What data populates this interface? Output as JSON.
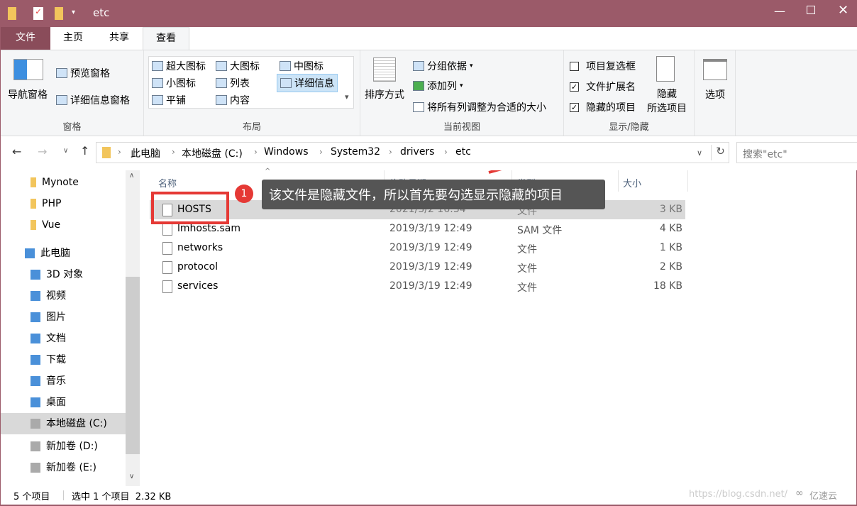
{
  "window": {
    "title": "etc"
  },
  "tabs": [
    "文件",
    "主页",
    "共享",
    "查看"
  ],
  "ribbon": {
    "panes": {
      "nav": "导航窗格",
      "preview": "预览窗格",
      "details": "详细信息窗格",
      "label": "窗格"
    },
    "layout": {
      "items": [
        "超大图标",
        "大图标",
        "中图标",
        "小图标",
        "列表",
        "详细信息",
        "平铺",
        "内容"
      ],
      "selected": "详细信息",
      "label": "布局"
    },
    "view": {
      "sort": "排序方式",
      "group": "分组依据",
      "add_col": "添加列",
      "fit": "将所有列调整为合适的大小",
      "label": "当前视图"
    },
    "show": {
      "item_cb": "项目复选框",
      "ext": "文件扩展名",
      "hidden": "隐藏的项目",
      "item_cb_checked": false,
      "ext_checked": true,
      "hidden_checked": true,
      "hide_sel_1": "隐藏",
      "hide_sel_2": "所选项目",
      "label": "显示/隐藏"
    },
    "options": "选项"
  },
  "address": {
    "crumbs": [
      "此电脑",
      "本地磁盘 (C:)",
      "Windows",
      "System32",
      "drivers",
      "etc"
    ],
    "search_placeholder": "搜索\"etc\""
  },
  "sidebar": [
    {
      "label": "Mynote",
      "icon": "folder-icon"
    },
    {
      "label": "PHP",
      "icon": "folder-icon"
    },
    {
      "label": "Vue",
      "icon": "folder-icon"
    },
    {
      "label": "此电脑",
      "icon": "computer-icon"
    },
    {
      "label": "3D 对象",
      "icon": "3d-icon"
    },
    {
      "label": "视频",
      "icon": "video-icon"
    },
    {
      "label": "图片",
      "icon": "picture-icon"
    },
    {
      "label": "文档",
      "icon": "document-icon"
    },
    {
      "label": "下载",
      "icon": "download-icon"
    },
    {
      "label": "音乐",
      "icon": "music-icon"
    },
    {
      "label": "桌面",
      "icon": "desktop-icon"
    },
    {
      "label": "本地磁盘 (C:)",
      "icon": "drive-icon"
    },
    {
      "label": "新加卷 (D:)",
      "icon": "drive-icon"
    },
    {
      "label": "新加卷 (E:)",
      "icon": "drive-icon"
    }
  ],
  "columns": [
    "名称",
    "修改日期",
    "类型",
    "大小"
  ],
  "files": [
    {
      "name": "HOSTS",
      "date": "2021/3/2 16:34",
      "type": "文件",
      "size": "3 KB"
    },
    {
      "name": "lmhosts.sam",
      "date": "2019/3/19 12:49",
      "type": "SAM 文件",
      "size": "4 KB"
    },
    {
      "name": "networks",
      "date": "2019/3/19 12:49",
      "type": "文件",
      "size": "1 KB"
    },
    {
      "name": "protocol",
      "date": "2019/3/19 12:49",
      "type": "文件",
      "size": "2 KB"
    },
    {
      "name": "services",
      "date": "2019/3/19 12:49",
      "type": "文件",
      "size": "18 KB"
    }
  ],
  "annotation": {
    "number": "1",
    "text": "该文件是隐藏文件，所以首先要勾选显示隐藏的项目"
  },
  "status": {
    "count": "5 个项目",
    "selected": "选中 1 个项目  2.32 KB"
  },
  "watermark": {
    "url": "https://blog.csdn.net/",
    "brand": "亿速云"
  },
  "colors": {
    "titlebar": "#9b5a69",
    "highlight": "#e53935",
    "selected_row": "#d9d9d9"
  }
}
